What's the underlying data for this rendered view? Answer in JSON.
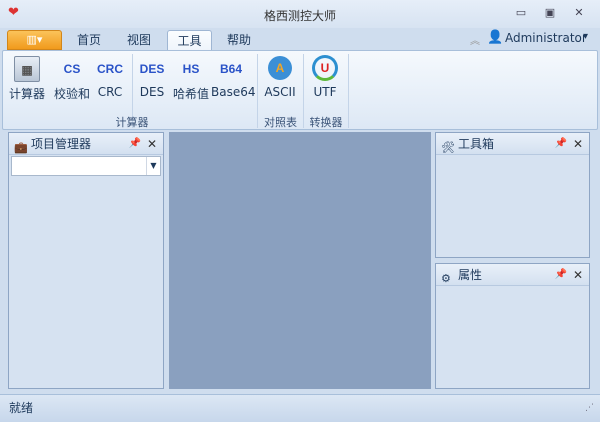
{
  "window": {
    "title": "格西测控大师",
    "minimize": "▭",
    "maximize": "▣",
    "close": "✕"
  },
  "tabs": [
    "首页",
    "视图",
    "工具",
    "帮助"
  ],
  "app_button": "▥▾",
  "user": {
    "name": "Administrator",
    "dropdown": "▾"
  },
  "ribbon": {
    "buttons": [
      {
        "label": "计算器",
        "icon": "calculator-icon"
      },
      {
        "label": "校验和",
        "icon_text": "CS"
      },
      {
        "label": "CRC",
        "icon_text": "CRC"
      },
      {
        "label": "DES",
        "icon_text": "DES"
      },
      {
        "label": "哈希值",
        "icon_text": "HS"
      },
      {
        "label": "Base64",
        "icon_text": "B64"
      },
      {
        "label": "ASCII",
        "icon_text": "A"
      },
      {
        "label": "UTF",
        "icon_text": "U"
      }
    ],
    "groups": [
      "计算器",
      "对照表",
      "转换器"
    ]
  },
  "panels": {
    "project": "项目管理器",
    "toolbox": "工具箱",
    "properties": "属性",
    "project_select_value": ""
  },
  "status": "就绪",
  "colors": {
    "accent": "#f19a1c",
    "workspace": "#8aa0bf"
  }
}
